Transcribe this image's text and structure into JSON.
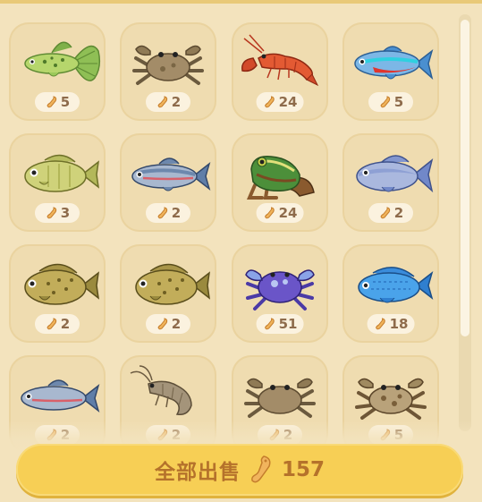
{
  "inventory": {
    "items": [
      {
        "name": "guppy",
        "price": "5"
      },
      {
        "name": "crab",
        "price": "2"
      },
      {
        "name": "shrimp",
        "price": "24"
      },
      {
        "name": "neon-tetra",
        "price": "5"
      },
      {
        "name": "bluegill",
        "price": "3"
      },
      {
        "name": "minnow",
        "price": "2"
      },
      {
        "name": "frog",
        "price": "24"
      },
      {
        "name": "blue-carp",
        "price": "2"
      },
      {
        "name": "sunfish",
        "price": "2"
      },
      {
        "name": "sunfish",
        "price": "2"
      },
      {
        "name": "purple-crab",
        "price": "51"
      },
      {
        "name": "blue-cichlid",
        "price": "18"
      },
      {
        "name": "minnow",
        "price": "2"
      },
      {
        "name": "river-shrimp",
        "price": "2"
      },
      {
        "name": "crab",
        "price": "2"
      },
      {
        "name": "spotted-crab",
        "price": "5"
      }
    ]
  },
  "sell_all": {
    "label": "全部出售",
    "total": "157",
    "icon": "bait-icon"
  },
  "colors": {
    "button": "#f7cf55",
    "button_text": "#b5722b",
    "card": "#efdcb0",
    "price_text": "#8e6b4b"
  }
}
